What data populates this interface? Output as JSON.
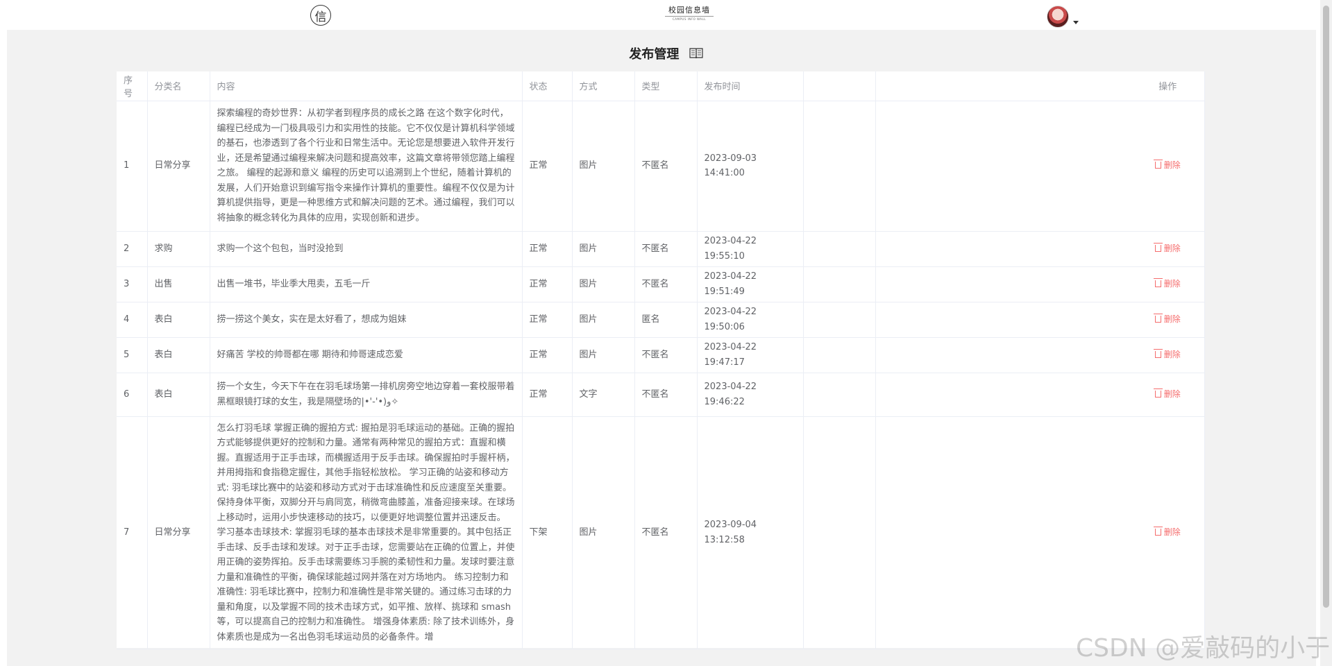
{
  "header": {
    "logo_glyph": "信",
    "brand_title": "校园信息墙",
    "brand_subtitle": "CAMPUS INFO WALL",
    "avatar_alt": "user-avatar"
  },
  "page": {
    "title": "发布管理"
  },
  "table": {
    "columns": {
      "index": "序号",
      "category": "分类名",
      "content": "内容",
      "status": "状态",
      "method": "方式",
      "type": "类型",
      "time": "发布时间",
      "ops": "操作"
    },
    "delete_label": "删除",
    "rows": [
      {
        "index": "1",
        "category": "日常分享",
        "content": "探索编程的奇妙世界：从初学者到程序员的成长之路 在这个数字化时代，编程已经成为一门极具吸引力和实用性的技能。它不仅仅是计算机科学领域的基石，也渗透到了各个行业和日常生活中。无论您是想要进入软件开发行业，还是希望通过编程来解决问题和提高效率，这篇文章将带领您踏上编程之旅。 编程的起源和意义 编程的历史可以追溯到上个世纪，随着计算机的发展，人们开始意识到编写指令来操作计算机的重要性。编程不仅仅是为计算机提供指导，更是一种思维方式和解决问题的艺术。通过编程，我们可以将抽象的概念转化为具体的应用，实现创新和进步。",
        "status": "正常",
        "method": "图片",
        "type": "不匿名",
        "time": "2023-09-03 14:41:00"
      },
      {
        "index": "2",
        "category": "求购",
        "content": "求购一个这个包包，当时没抢到",
        "status": "正常",
        "method": "图片",
        "type": "不匿名",
        "time": "2023-04-22 19:55:10"
      },
      {
        "index": "3",
        "category": "出售",
        "content": "出售一堆书，毕业季大甩卖，五毛一斤",
        "status": "正常",
        "method": "图片",
        "type": "不匿名",
        "time": "2023-04-22 19:51:49"
      },
      {
        "index": "4",
        "category": "表白",
        "content": "捞一捞这个美女，实在是太好看了，想成为姐妹",
        "status": "正常",
        "method": "图片",
        "type": "匿名",
        "time": "2023-04-22 19:50:06"
      },
      {
        "index": "5",
        "category": "表白",
        "content": "好痛苦 学校的帅哥都在哪 期待和帅哥速成恋爱",
        "status": "正常",
        "method": "图片",
        "type": "不匿名",
        "time": "2023-04-22 19:47:17"
      },
      {
        "index": "6",
        "category": "表白",
        "content": "捞一个女生，今天下午在在羽毛球场第一排机房旁空地边穿着一套校服带着黑框眼镜打球的女生，我是隔壁场的|•'-'•)و✧",
        "status": "正常",
        "method": "文字",
        "type": "不匿名",
        "time": "2023-04-22 19:46:22"
      },
      {
        "index": "7",
        "category": "日常分享",
        "content": "怎么打羽毛球 掌握正确的握拍方式: 握拍是羽毛球运动的基础。正确的握拍方式能够提供更好的控制和力量。通常有两种常见的握拍方式：直握和横握。直握适用于正手击球，而横握适用于反手击球。确保握拍时手握杆柄，并用拇指和食指稳定握住，其他手指轻松放松。 学习正确的站姿和移动方式: 羽毛球比赛中的站姿和移动方式对于击球准确性和反应速度至关重要。保持身体平衡，双脚分开与肩同宽，稍微弯曲膝盖，准备迎接来球。在球场上移动时，运用小步快速移动的技巧，以便更好地调整位置并迅速反击。 学习基本击球技术: 掌握羽毛球的基本击球技术是非常重要的。其中包括正手击球、反手击球和发球。对于正手击球，您需要站在正确的位置上，并使用正确的姿势挥拍。反手击球需要练习手腕的柔韧性和力量。发球时要注意力量和准确性的平衡，确保球能越过网并落在对方场地内。 练习控制力和准确性: 羽毛球比赛中，控制力和准确性是非常关键的。通过练习击球的力量和角度，以及掌握不同的技术击球方式，如平推、放样、挑球和 smash 等，可以提高自己的控制力和准确性。 增强身体素质: 除了技术训练外，身体素质也是成为一名出色羽毛球运动员的必备条件。增",
        "status": "下架",
        "method": "图片",
        "type": "不匿名",
        "time": "2023-09-04 13:12:58"
      }
    ]
  },
  "watermark": "CSDN @爱敲码的小于",
  "colors": {
    "danger": "#f56c6c",
    "header_text": "#909399",
    "cell_text": "#606266",
    "border": "#ebeef5",
    "page_bg": "#f2f2f2"
  }
}
